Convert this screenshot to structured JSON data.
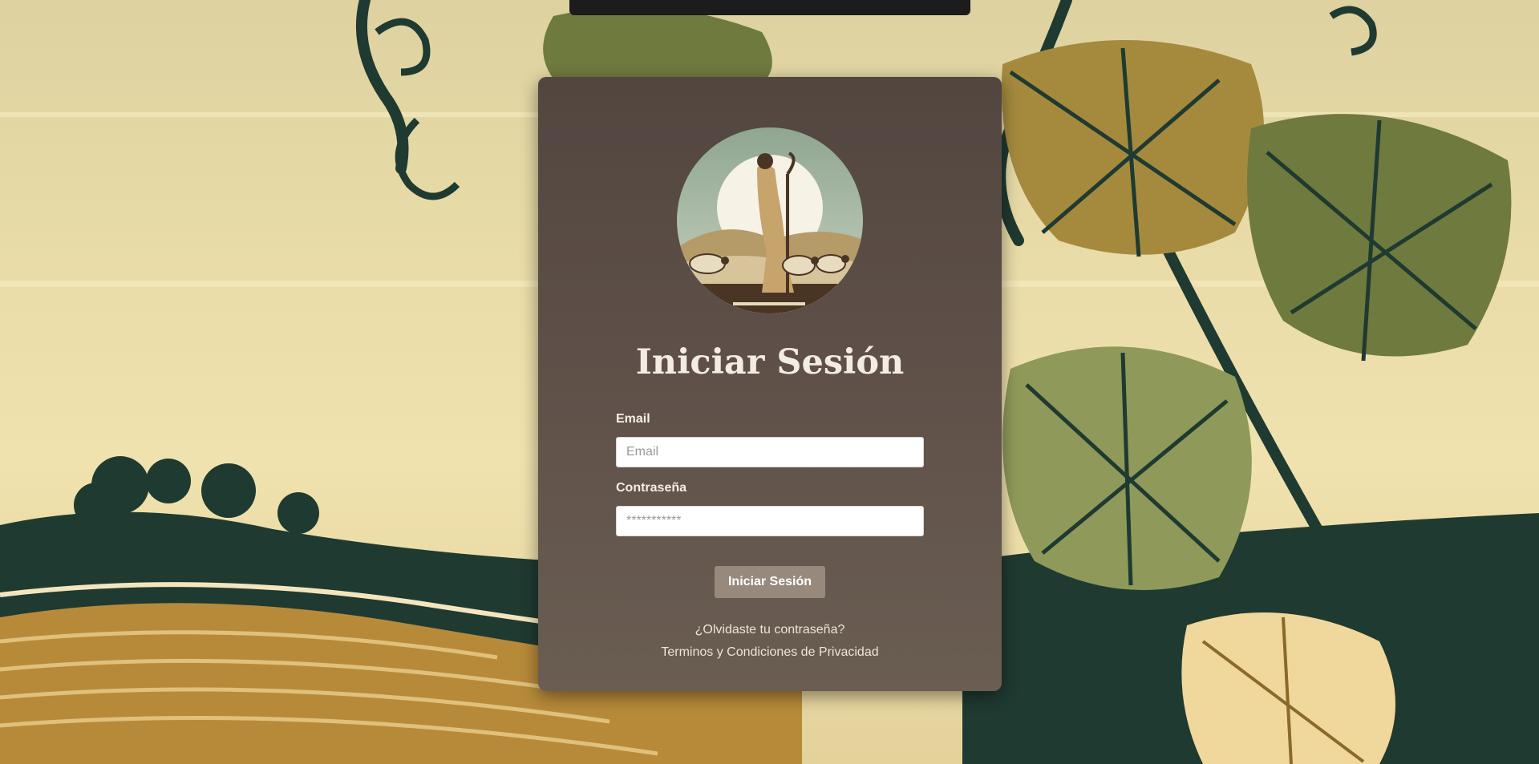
{
  "login": {
    "title": "Iniciar Sesión",
    "email_label": "Email",
    "email_placeholder": "Email",
    "password_label": "Contraseña",
    "password_placeholder": "***********",
    "submit_label": "Iniciar Sesión",
    "forgot_link": "¿Olvidaste tu contraseña?",
    "terms_link": "Terminos y Condiciones de Privacidad"
  },
  "theme": {
    "card": "#5e5048",
    "button": "#978a7d",
    "background": "#e9dcab",
    "foliage_dark": "#1f3a31",
    "foliage_olive": "#8f9a5a"
  },
  "icons": {
    "logo": "shepherd-with-sheep-logo"
  }
}
